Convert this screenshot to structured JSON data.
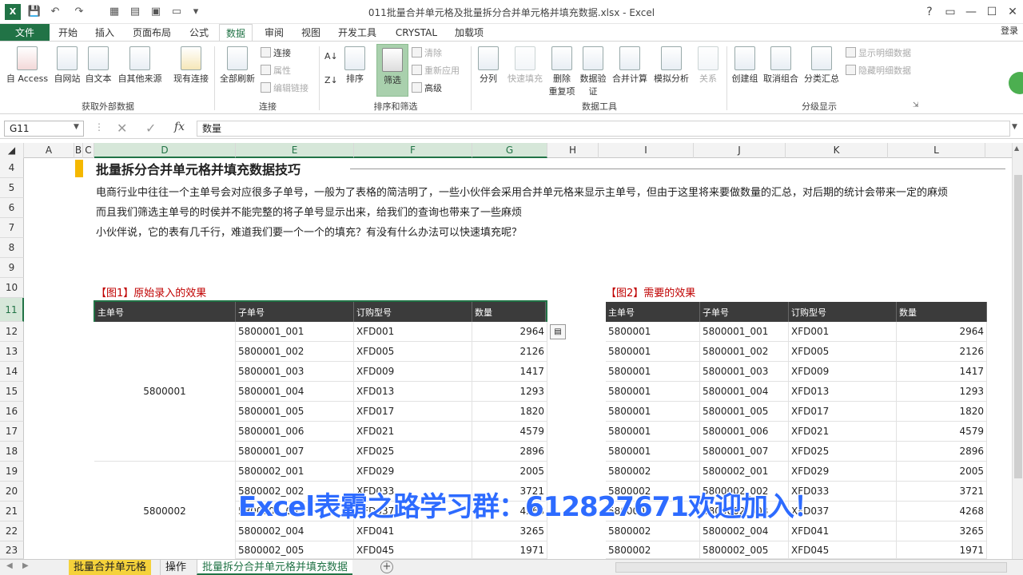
{
  "window": {
    "title": "011批量合并单元格及批量拆分合并单元格并填充数据.xlsx - Excel",
    "help": "?",
    "restore": "▭",
    "minimize": "—",
    "maximize": "☐",
    "close": "✕",
    "login": "登录"
  },
  "tabs": [
    "文件",
    "开始",
    "插入",
    "页面布局",
    "公式",
    "数据",
    "审阅",
    "视图",
    "开发工具",
    "CRYSTAL",
    "加载项"
  ],
  "ribbon": {
    "external": {
      "access": "自 Access",
      "web": "自网站",
      "text": "自文本",
      "other": "自其他来源",
      "existing": "现有连接",
      "label": "获取外部数据"
    },
    "connections": {
      "refresh_all": "全部刷新",
      "connections": "连接",
      "properties": "属性",
      "edit_links": "编辑链接",
      "label": "连接"
    },
    "sort": {
      "sort": "排序",
      "filter": "筛选",
      "clear": "清除",
      "reapply": "重新应用",
      "advanced": "高级",
      "label": "排序和筛选"
    },
    "tools": {
      "text_to_columns": "分列",
      "flash_fill": "快速填充",
      "remove_dup_1": "删除",
      "remove_dup_2": "重复项",
      "validation_1": "数据验",
      "validation_2": "证",
      "consolidate": "合并计算",
      "what_if": "模拟分析",
      "relationships": "关系",
      "label": "数据工具"
    },
    "outline": {
      "group": "创建组",
      "ungroup": "取消组合",
      "subtotal": "分类汇总",
      "show_detail": "显示明细数据",
      "hide_detail": "隐藏明细数据",
      "label": "分级显示"
    }
  },
  "formula_bar": {
    "name_box": "G11",
    "fx": "fx",
    "content": "数量"
  },
  "columns": [
    "A",
    "B",
    "C",
    "D",
    "E",
    "F",
    "G",
    "H",
    "I",
    "J",
    "K",
    "L"
  ],
  "rows": [
    "4",
    "5",
    "6",
    "7",
    "8",
    "9",
    "10",
    "11",
    "12",
    "13",
    "14",
    "15",
    "16",
    "17",
    "18",
    "19",
    "20",
    "21",
    "22",
    "23"
  ],
  "content": {
    "heading": "批量拆分合并单元格并填充数据技巧",
    "line1": "电商行业中往往一个主单号会对应很多子单号，一般为了表格的简洁明了，一些小伙伴会采用合并单元格来显示主单号，但由于这里将来要做数量的汇总，对后期的统计会带来一定的麻烦",
    "line2": "而且我们筛选主单号的时侯并不能完整的将子单号显示出来，给我们的查询也带来了一些麻烦",
    "line3": "小伙伴说，它的表有几千行，难道我们要一个一个的填充？有没有什么办法可以快速填充呢？",
    "fig1": "【图1】原始录入的效果",
    "fig2": "【图2】需要的效果"
  },
  "table1": {
    "headers": [
      "主单号",
      "子单号",
      "订购型号",
      "数量"
    ],
    "merged": [
      "5800001",
      "5800002"
    ],
    "rows": [
      [
        "5800001_001",
        "XFD001",
        "2964"
      ],
      [
        "5800001_002",
        "XFD005",
        "2126"
      ],
      [
        "5800001_003",
        "XFD009",
        "1417"
      ],
      [
        "5800001_004",
        "XFD013",
        "1293"
      ],
      [
        "5800001_005",
        "XFD017",
        "1820"
      ],
      [
        "5800001_006",
        "XFD021",
        "4579"
      ],
      [
        "5800001_007",
        "XFD025",
        "2896"
      ],
      [
        "5800002_001",
        "XFD029",
        "2005"
      ],
      [
        "5800002_002",
        "XFD033",
        "3721"
      ],
      [
        "5800002_003",
        "XFD037",
        "4268"
      ],
      [
        "5800002_004",
        "XFD041",
        "3265"
      ],
      [
        "5800002_005",
        "XFD045",
        "1971"
      ]
    ]
  },
  "table2": {
    "headers": [
      "主单号",
      "子单号",
      "订购型号",
      "数量"
    ],
    "rows": [
      [
        "5800001",
        "5800001_001",
        "XFD001",
        "2964"
      ],
      [
        "5800001",
        "5800001_002",
        "XFD005",
        "2126"
      ],
      [
        "5800001",
        "5800001_003",
        "XFD009",
        "1417"
      ],
      [
        "5800001",
        "5800001_004",
        "XFD013",
        "1293"
      ],
      [
        "5800001",
        "5800001_005",
        "XFD017",
        "1820"
      ],
      [
        "5800001",
        "5800001_006",
        "XFD021",
        "4579"
      ],
      [
        "5800001",
        "5800001_007",
        "XFD025",
        "2896"
      ],
      [
        "5800002",
        "5800002_001",
        "XFD029",
        "2005"
      ],
      [
        "5800002",
        "5800002_002",
        "XFD033",
        "3721"
      ],
      [
        "5800002",
        "5800002_003",
        "XFD037",
        "4268"
      ],
      [
        "5800002",
        "5800002_004",
        "XFD041",
        "3265"
      ],
      [
        "5800002",
        "5800002_005",
        "XFD045",
        "1971"
      ]
    ]
  },
  "watermark": "Excel表霸之路学习群：612827671欢迎加入！",
  "sheets": [
    "批量合并单元格",
    "操作",
    "批量拆分合并单元格并填充数据"
  ],
  "colors": {
    "accent": "#217346",
    "header_dark": "#3b3b3b",
    "fig_label": "#c00000",
    "heading_bar": "#f5b800"
  }
}
